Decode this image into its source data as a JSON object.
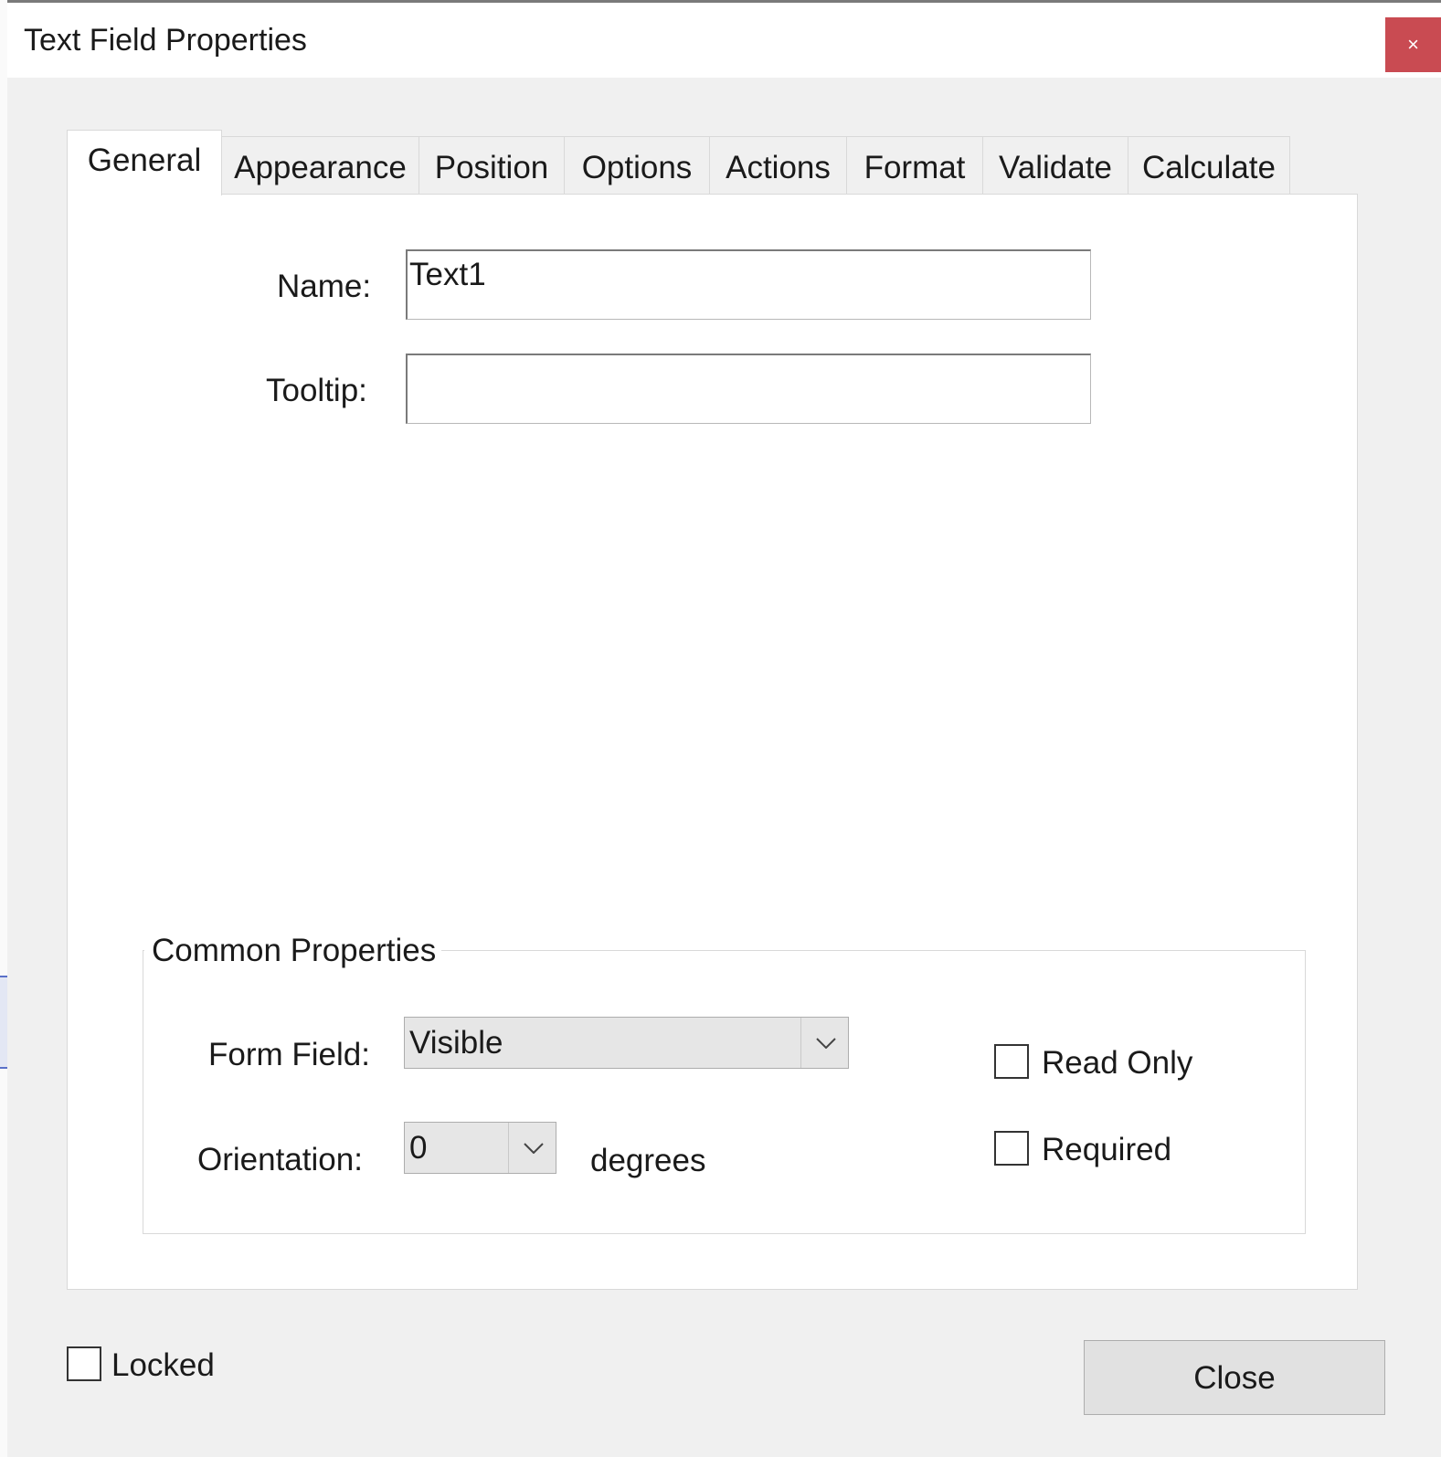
{
  "dialog": {
    "title": "Text Field Properties",
    "close_icon_glyph": "×"
  },
  "tabs": [
    {
      "label": "General",
      "active": true
    },
    {
      "label": "Appearance",
      "active": false
    },
    {
      "label": "Position",
      "active": false
    },
    {
      "label": "Options",
      "active": false
    },
    {
      "label": "Actions",
      "active": false
    },
    {
      "label": "Format",
      "active": false
    },
    {
      "label": "Validate",
      "active": false
    },
    {
      "label": "Calculate",
      "active": false
    }
  ],
  "general": {
    "name_label": "Name:",
    "name_value": "Text1",
    "tooltip_label": "Tooltip:",
    "tooltip_value": ""
  },
  "common_properties": {
    "legend": "Common Properties",
    "form_field_label": "Form Field:",
    "form_field_value": "Visible",
    "orientation_label": "Orientation:",
    "orientation_value": "0",
    "orientation_unit": "degrees",
    "read_only_label": "Read Only",
    "read_only_checked": false,
    "required_label": "Required",
    "required_checked": false
  },
  "footer": {
    "locked_label": "Locked",
    "locked_checked": false,
    "close_button_label": "Close"
  },
  "colors": {
    "close_x_bg": "#c94b52",
    "dialog_bg": "#f0f0f0",
    "panel_bg": "#ffffff",
    "button_bg": "#e1e1e1"
  },
  "icons": {
    "dropdown": "chevron-down-icon",
    "close": "close-icon"
  }
}
